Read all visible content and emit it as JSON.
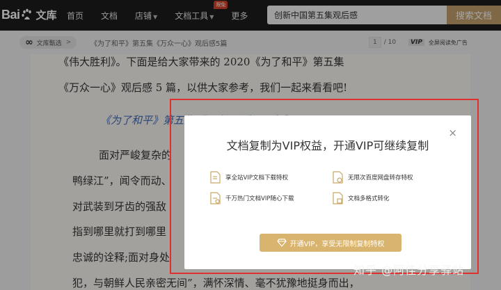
{
  "nav": {
    "logo_text": "Bai",
    "logo_suffix": "文库",
    "items": [
      {
        "label": "首页"
      },
      {
        "label": "文档"
      },
      {
        "label": "店铺"
      },
      {
        "label": "文档工具",
        "badge": "限免"
      },
      {
        "label": "更多"
      }
    ],
    "search_value": "创新中国第五集观后感",
    "search_button": "搜索文档"
  },
  "subbar": {
    "tag": "文库甄选",
    "doc_title": "《为了和平》第五集《万众一心》观后感5篇",
    "page_current": "1",
    "page_total": "/ 10",
    "vip_mark": "VIP",
    "vip_text": "全屏阅读免广告"
  },
  "document": {
    "line1": "《伟大胜利》。下面是给大家带来的 2020《为了和平》第五集",
    "line2": "《万众一心》观后感 5 篇，以供大家参考，我们一起来看看吧!",
    "heading": "《为了和平》第五集《万众一心》观后感",
    "line3": "面对严峻复杂的",
    "line4": "鸭绿江”，闻令而动、",
    "line5": "对武装到牙齿的强敌",
    "line6": "指到哪里就打到哪里",
    "line7": "忠诚的诠释;面对身处",
    "line8": "犯，与朝鲜人民亲密无间”，满怀深情、毫不犹豫地挺身而出，"
  },
  "modal": {
    "close": "×",
    "title": "文档复制为VIP权益，开通VIP可继续复制",
    "benefits": [
      "享全站VIP文档下载特权",
      "无限次百度网盘转存特权",
      "千万热门文档VIP随心下载",
      "文档多格式转化"
    ],
    "button": "开通VIP，享受无限制复制特权"
  },
  "watermark": "知乎 @阿佳分享驿站",
  "colors": {
    "topbar": "#1c1c1c",
    "accent_gold": "#c2a06a",
    "button_gold": "#d9b46e",
    "heading_blue": "#3e6bb8",
    "frame_red": "#e0302e"
  }
}
